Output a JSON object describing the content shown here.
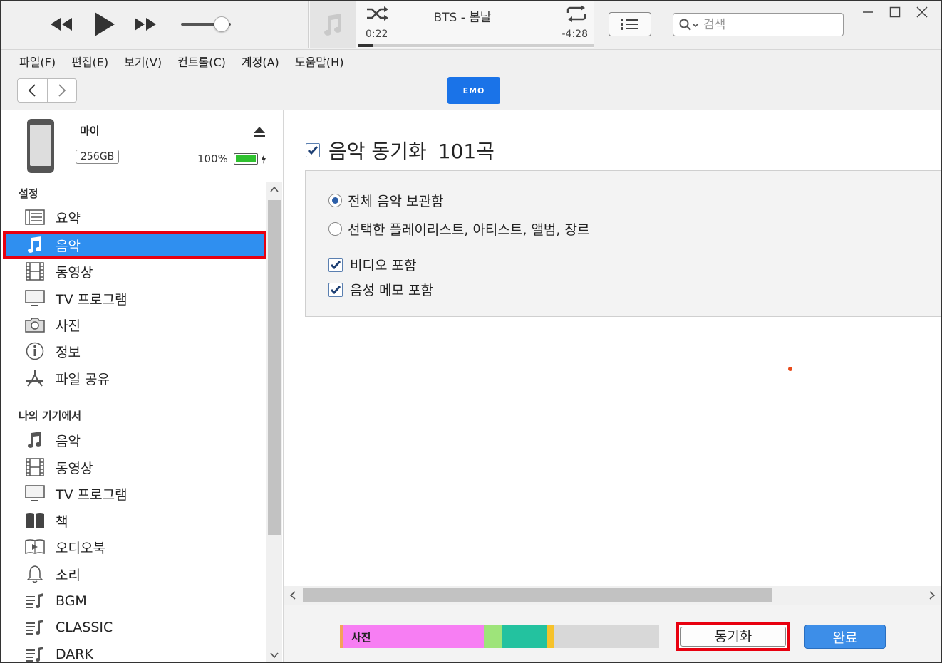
{
  "player": {
    "track_title": "BTS - 봄날",
    "elapsed": "0:22",
    "remaining": "-4:28",
    "progress_fraction": 0.06,
    "volume_fraction": 0.82
  },
  "search": {
    "placeholder": "검색"
  },
  "menu": [
    "파일(F)",
    "편집(E)",
    "보기(V)",
    "컨트롤(C)",
    "계정(A)",
    "도움말(H)"
  ],
  "nav": {
    "device_pill_label": "EMO"
  },
  "device": {
    "name": "마이",
    "capacity": "256GB",
    "battery": "100%",
    "battery_fraction": 1.0
  },
  "sidebar": {
    "settings_header": "설정",
    "settings_items": [
      {
        "label": "요약",
        "icon": "summary-icon"
      },
      {
        "label": "음악",
        "icon": "music-note-icon",
        "selected": true
      },
      {
        "label": "동영상",
        "icon": "film-icon"
      },
      {
        "label": "TV 프로그램",
        "icon": "tv-icon"
      },
      {
        "label": "사진",
        "icon": "camera-icon"
      },
      {
        "label": "정보",
        "icon": "info-icon"
      },
      {
        "label": "파일 공유",
        "icon": "app-store-icon"
      }
    ],
    "ondevice_header": "나의 기기에서",
    "ondevice_items": [
      {
        "label": "음악",
        "icon": "music-note-icon"
      },
      {
        "label": "동영상",
        "icon": "film-icon"
      },
      {
        "label": "TV 프로그램",
        "icon": "tv-icon"
      },
      {
        "label": "책",
        "icon": "book-icon"
      },
      {
        "label": "오디오북",
        "icon": "audiobook-icon"
      },
      {
        "label": "소리",
        "icon": "bell-icon"
      },
      {
        "label": "BGM",
        "icon": "playlist-icon"
      },
      {
        "label": "CLASSIC",
        "icon": "playlist-icon"
      },
      {
        "label": "DARK",
        "icon": "playlist-icon"
      }
    ]
  },
  "main": {
    "sync_title": "음악 동기화",
    "sync_count": "101곡",
    "sync_checked": true,
    "radio_all": "전체 음악 보관함",
    "radio_selected": "선택한 플레이리스트, 아티스트, 앨범, 장르",
    "radio_all_checked": true,
    "include_video": "비디오 포함",
    "include_video_checked": true,
    "include_voice_memo": "음성 메모 포함",
    "include_voice_memo_checked": true
  },
  "capacity_bar": {
    "label": "사진",
    "segments": [
      {
        "color": "#f4a25a",
        "fraction": 0.01
      },
      {
        "color": "#f77ef3",
        "fraction": 0.44
      },
      {
        "color": "#9ee47a",
        "fraction": 0.06
      },
      {
        "color": "#23c29f",
        "fraction": 0.14
      },
      {
        "color": "#f6c22a",
        "fraction": 0.02
      }
    ]
  },
  "buttons": {
    "sync": "동기화",
    "done": "완료"
  },
  "colors": {
    "accent": "#2f8ff0",
    "highlight_border": "#e8000f",
    "done_button": "#3d8ee8"
  }
}
